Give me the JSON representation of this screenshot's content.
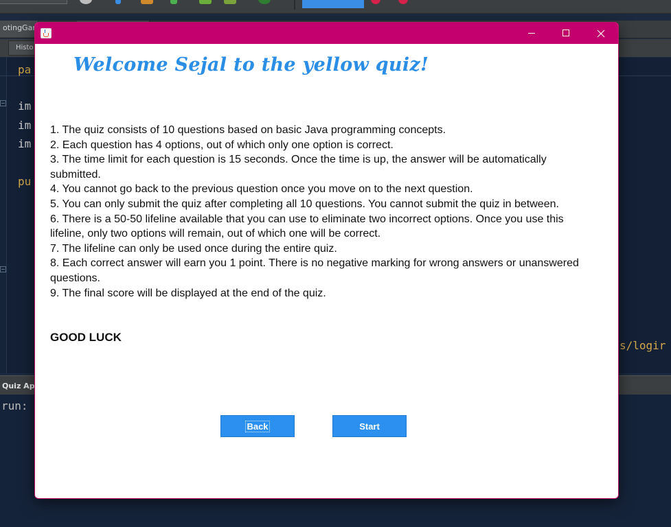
{
  "ide": {
    "editor_tab": "otingGar",
    "sub_tab": "Histo",
    "code_lines": [
      "pa",
      "im",
      "im",
      "im",
      "pu"
    ],
    "code_right": "s/logir",
    "output_tab": "Quiz App",
    "output_text": "run:"
  },
  "window": {
    "title": "",
    "titlebar_color": "#c4006f",
    "minimize_glyph": "—",
    "close_glyph": "✕"
  },
  "welcome_text": "Welcome Sejal to the yellow quiz!",
  "rules": [
    "1. The quiz consists of 10 questions based on basic Java programming concepts.",
    "2. Each question has 4 options, out of which only one option is correct.",
    "3. The time limit for each question is 15 seconds. Once the time is up, the answer will be automatically submitted.",
    "4. You cannot go back to the previous question once you move on to the next question.",
    "5. You can only submit the quiz after completing all 10 questions. You cannot submit the quiz in between.",
    "6. There is a 50-50 lifeline available that you can use to eliminate two incorrect options. Once you use this lifeline, only two options will remain, out of which one will be correct.",
    "7. The lifeline can only be used once during the entire quiz.",
    "8. Each correct answer will earn you 1 point. There is no negative marking for wrong answers or unanswered questions.",
    "9. The final score will be displayed at the end of the quiz."
  ],
  "good_luck": "GOOD LUCK",
  "buttons": {
    "back": "Back",
    "start": "Start",
    "color": "#2b90ef"
  }
}
